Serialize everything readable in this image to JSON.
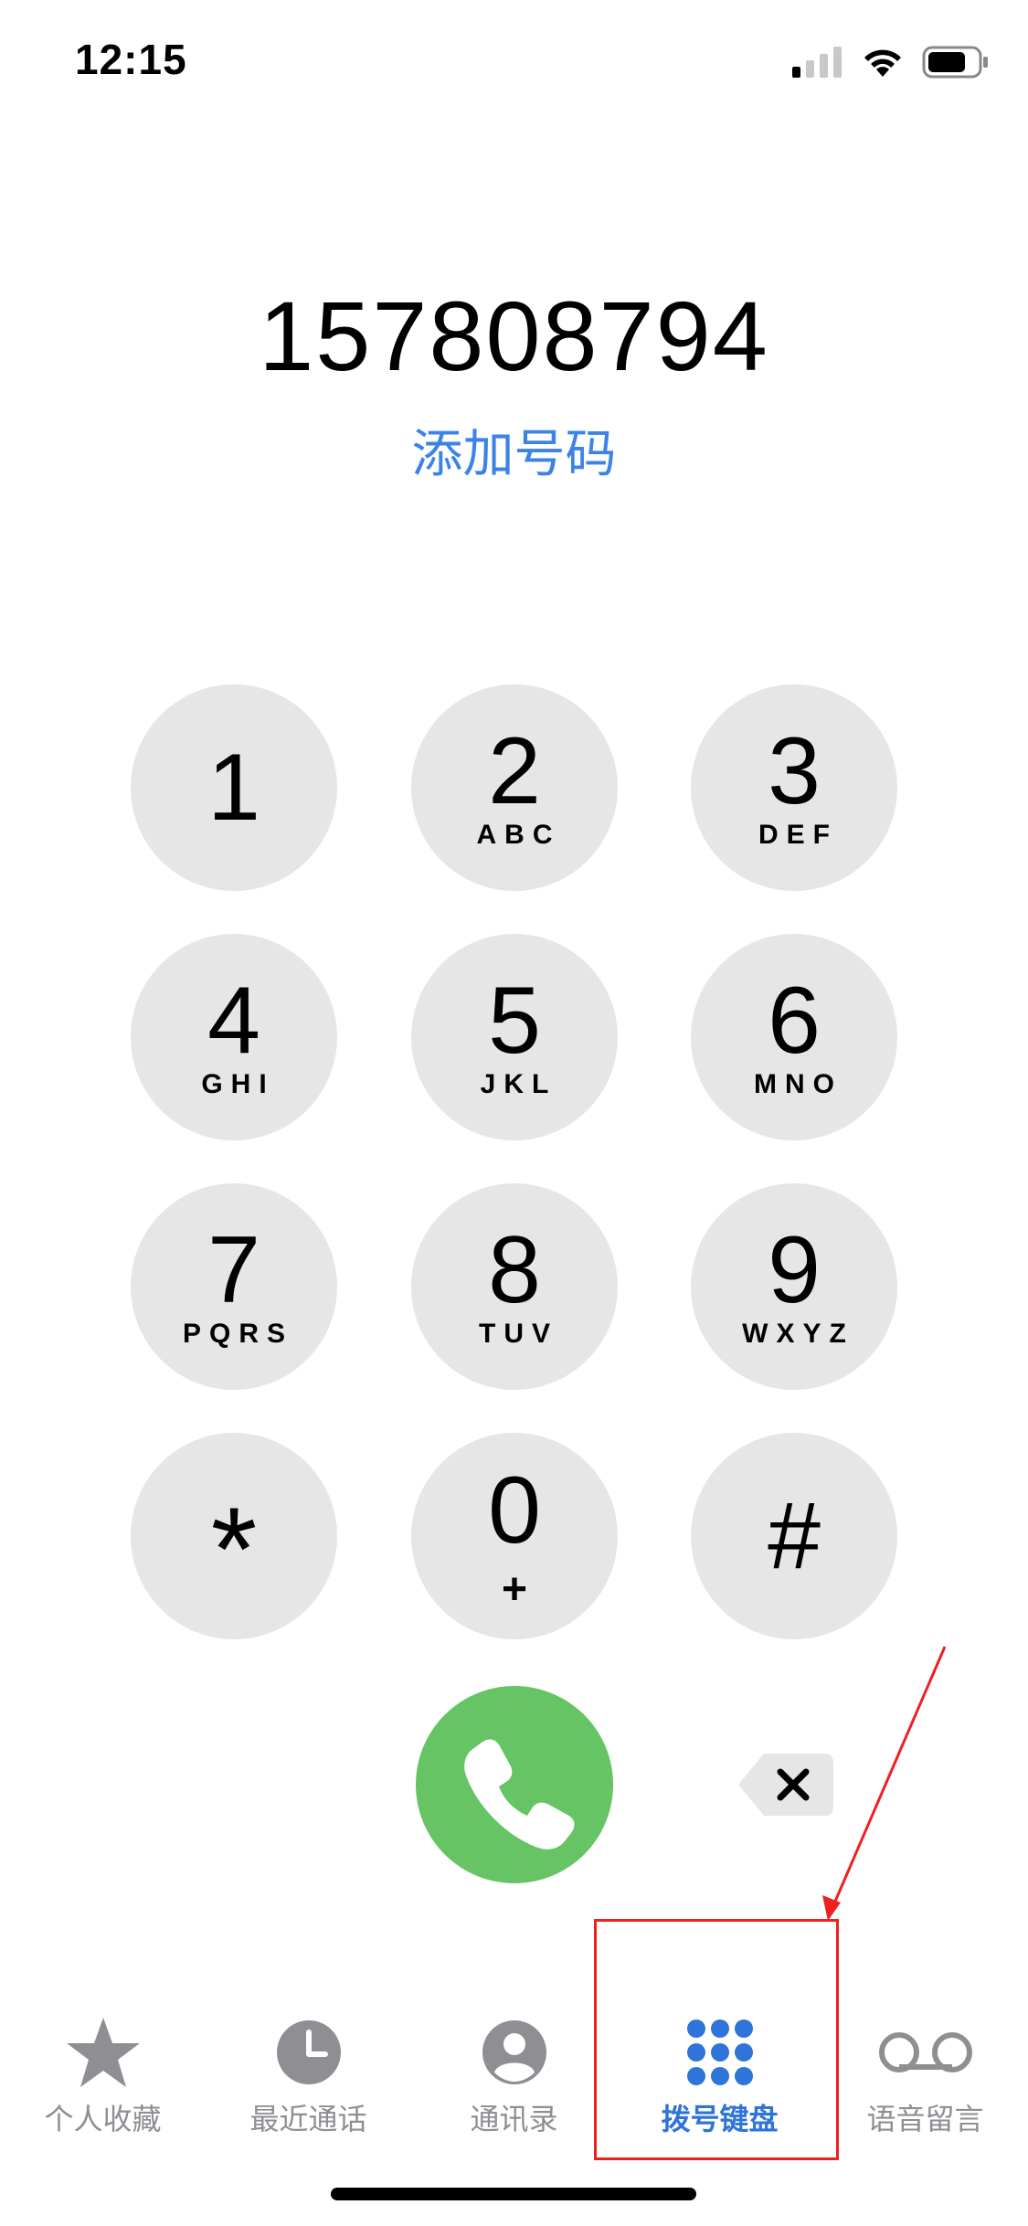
{
  "status_bar": {
    "time": "12:15"
  },
  "dialer": {
    "number": "157808794",
    "add_number_label": "添加号码"
  },
  "keypad": {
    "keys": [
      {
        "digit": "1",
        "letters": ""
      },
      {
        "digit": "2",
        "letters": "ABC"
      },
      {
        "digit": "3",
        "letters": "DEF"
      },
      {
        "digit": "4",
        "letters": "GHI"
      },
      {
        "digit": "5",
        "letters": "JKL"
      },
      {
        "digit": "6",
        "letters": "MNO"
      },
      {
        "digit": "7",
        "letters": "PQRS"
      },
      {
        "digit": "8",
        "letters": "TUV"
      },
      {
        "digit": "9",
        "letters": "WXYZ"
      },
      {
        "digit": "*",
        "letters": ""
      },
      {
        "digit": "0",
        "letters": "+"
      },
      {
        "digit": "#",
        "letters": ""
      }
    ],
    "call_icon": "phone-icon",
    "delete_icon": "backspace-icon"
  },
  "tab_bar": {
    "tabs": [
      {
        "label": "个人收藏",
        "icon": "star-icon",
        "active": false
      },
      {
        "label": "最近通话",
        "icon": "clock-icon",
        "active": false
      },
      {
        "label": "通讯录",
        "icon": "contact-icon",
        "active": false
      },
      {
        "label": "拨号键盘",
        "icon": "keypad-icon",
        "active": true
      },
      {
        "label": "语音留言",
        "icon": "voicemail-icon",
        "active": false
      }
    ]
  },
  "colors": {
    "accent": "#3b83e6",
    "call_green": "#66c465",
    "key_gray": "#e6e6e6",
    "tab_inactive": "#8e8e93",
    "annotation_red": "#ee2020"
  }
}
